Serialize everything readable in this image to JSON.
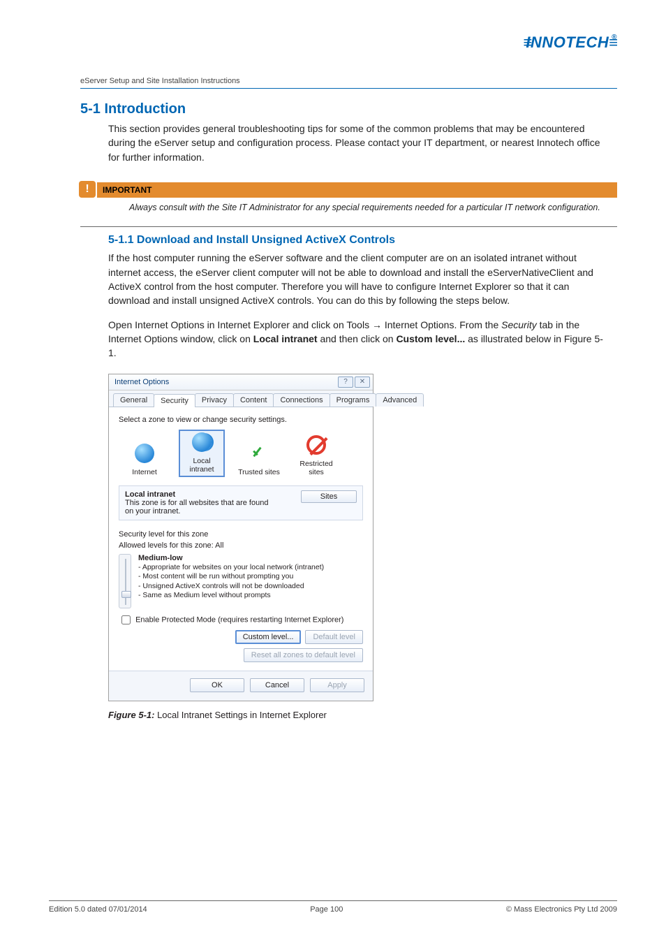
{
  "logo": {
    "text": "INNOTECH",
    "reg": "®"
  },
  "doc_title": "eServer Setup and Site Installation Instructions",
  "h1": "5-1  Introduction",
  "intro_para": "This section provides general troubleshooting tips for some of the common problems that may be encountered during the eServer setup and configuration process.  Please contact your IT department, or nearest Innotech office for further information.",
  "important": {
    "label": "IMPORTANT",
    "body": "Always consult with the Site IT Administrator for any special requirements needed for a particular IT network configuration."
  },
  "h2": "5-1.1  Download and Install Unsigned ActiveX Controls",
  "para2": "If the host computer running the eServer software and the client computer are on an isolated intranet without internet access, the eServer client computer will not be able to download and install the eServerNativeClient and ActiveX control from the host computer.   Therefore you will have to configure Internet Explorer so that it can download and install unsigned ActiveX controls.  You can do this by following the steps below.",
  "para3_a": "Open Internet Options in Internet Explorer and click on Tools ",
  "para3_arrow": "→",
  "para3_b": " Internet Options.  From the ",
  "para3_em": "Security",
  "para3_c": " tab in the Internet Options window, click on ",
  "para3_bold1": "Local intranet",
  "para3_d": " and then click on ",
  "para3_bold2": "Custom level...",
  "para3_e": " as illustrated below in Figure 5-1.",
  "dialog": {
    "title": "Internet Options",
    "help_btn": "?",
    "close_btn": "✕",
    "tabs": [
      "General",
      "Security",
      "Privacy",
      "Content",
      "Connections",
      "Programs",
      "Advanced"
    ],
    "active_tab_index": 1,
    "zone_prompt": "Select a zone to view or change security settings.",
    "zones": [
      "Internet",
      "Local intranet",
      "Trusted sites",
      "Restricted sites"
    ],
    "selected_zone_index": 1,
    "zone_info_title": "Local intranet",
    "zone_info_desc": "This zone is for all websites that are found on your intranet.",
    "sites_btn": "Sites",
    "sec_level_label": "Security level for this zone",
    "allowed_levels": "Allowed levels for this zone: All",
    "level_name": "Medium-low",
    "level_lines": [
      "- Appropriate for websites on your local network (intranet)",
      "- Most content will be run without prompting you",
      "- Unsigned ActiveX controls will not be downloaded",
      "- Same as Medium level without prompts"
    ],
    "protected_mode": "Enable Protected Mode (requires restarting Internet Explorer)",
    "custom_level_btn": "Custom level...",
    "default_level_btn": "Default level",
    "reset_btn": "Reset all zones to default level",
    "ok": "OK",
    "cancel": "Cancel",
    "apply": "Apply"
  },
  "figure": {
    "num": "Figure 5-1:",
    "caption": "   Local Intranet Settings in Internet Explorer"
  },
  "footer": {
    "left": "Edition 5.0 dated 07/01/2014",
    "center": "Page 100",
    "right": "© Mass Electronics Pty Ltd  2009"
  }
}
